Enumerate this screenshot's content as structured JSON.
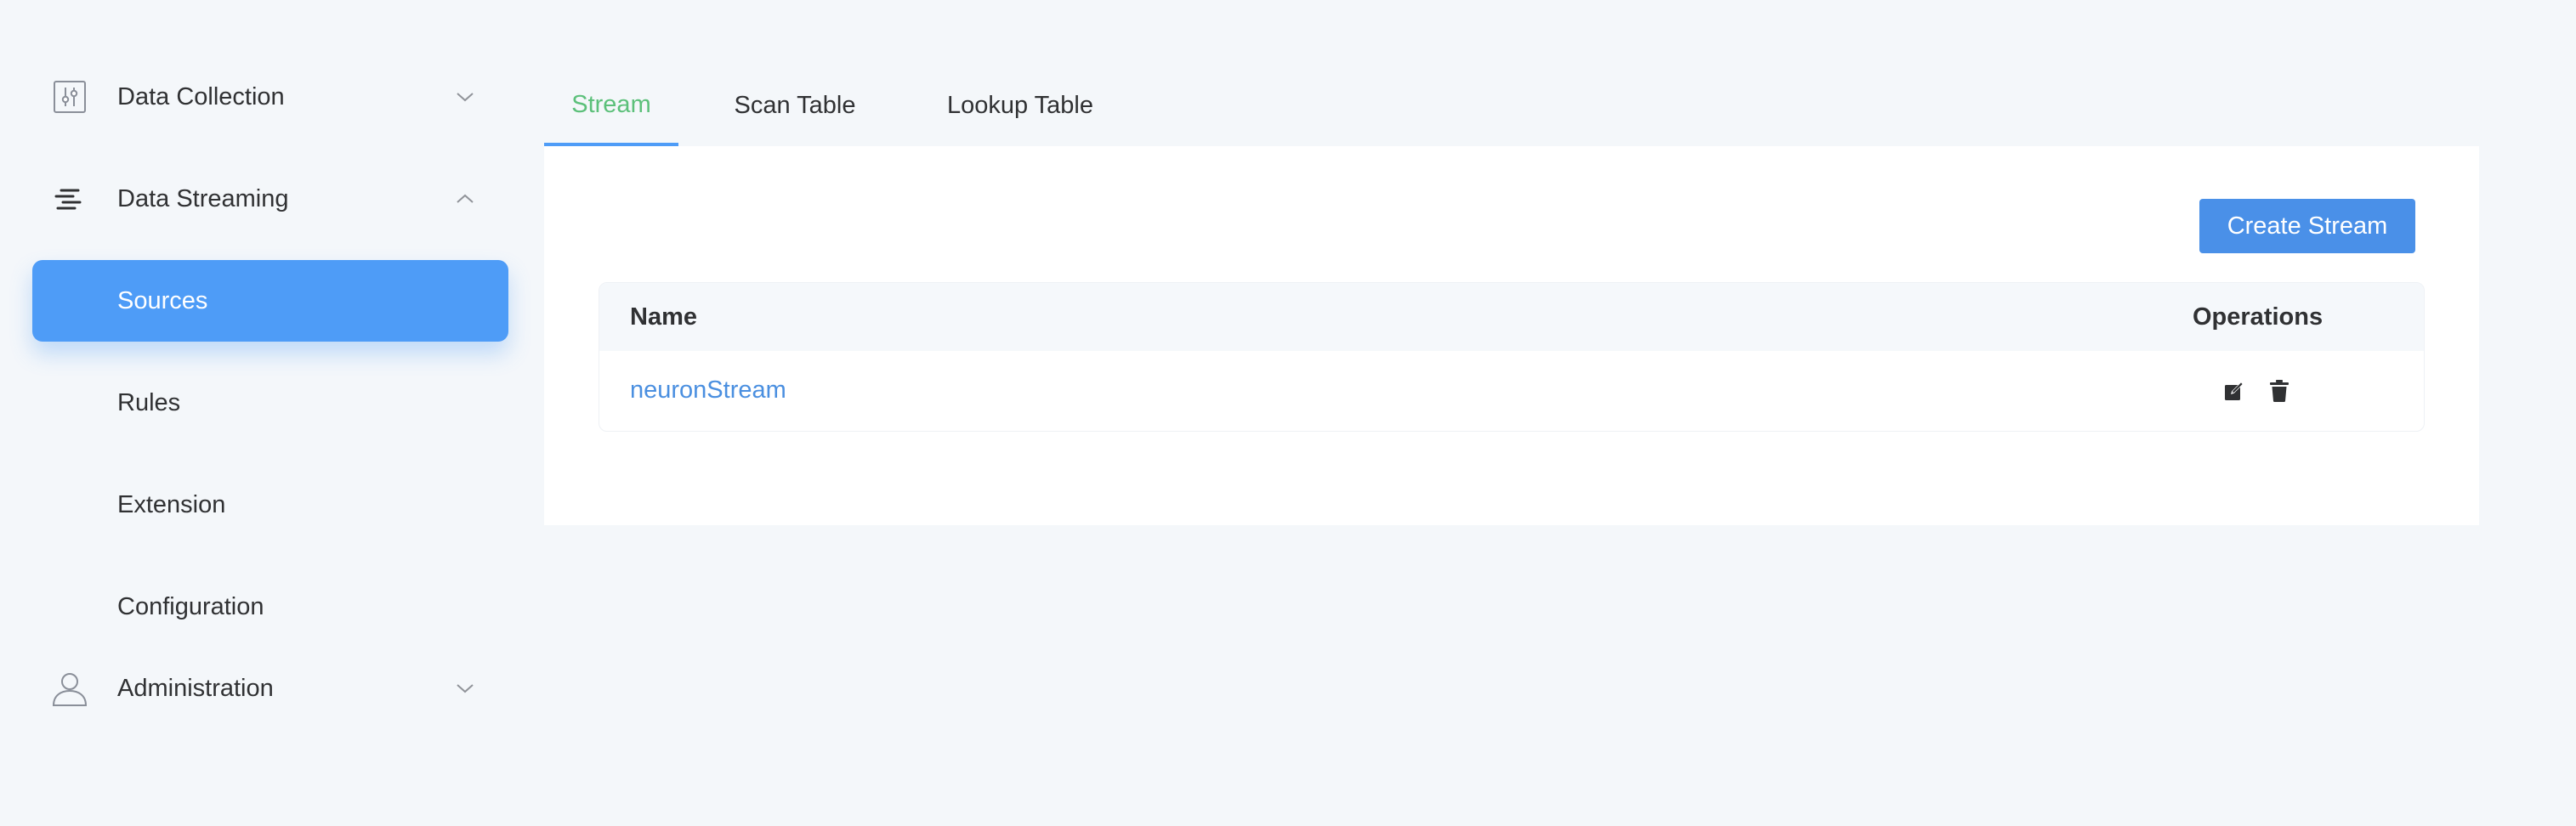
{
  "sidebar": {
    "groups": [
      {
        "label": "Data Collection",
        "icon": "sliders-icon",
        "expanded": false
      },
      {
        "label": "Data Streaming",
        "icon": "stream-lines-icon",
        "expanded": true
      },
      {
        "label": "Administration",
        "icon": "user-icon",
        "expanded": false
      }
    ],
    "streaming_items": [
      {
        "label": "Sources",
        "active": true
      },
      {
        "label": "Rules",
        "active": false
      },
      {
        "label": "Extension",
        "active": false
      },
      {
        "label": "Configuration",
        "active": false
      }
    ]
  },
  "tabs": [
    {
      "label": "Stream",
      "active": true
    },
    {
      "label": "Scan Table",
      "active": false
    },
    {
      "label": "Lookup Table",
      "active": false
    }
  ],
  "toolbar": {
    "create_label": "Create Stream"
  },
  "table": {
    "columns": [
      "Name",
      "Operations"
    ],
    "rows": [
      {
        "name": "neuronStream"
      }
    ],
    "operations": [
      {
        "icon": "edit-icon"
      },
      {
        "icon": "delete-icon"
      }
    ]
  },
  "colors": {
    "accent": "#4e9cf7",
    "button": "#4a90e8",
    "tab_active_text": "#5cc07a",
    "link": "#4a8fe0",
    "background": "#f4f7fa"
  }
}
